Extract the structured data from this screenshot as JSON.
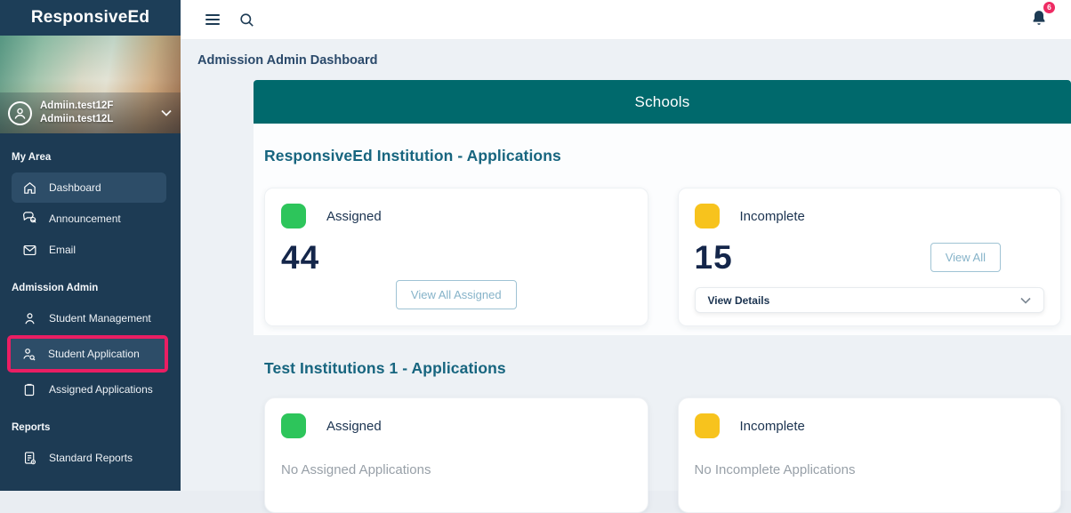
{
  "colors": {
    "sidebar_navy": "#1d3b54",
    "active_item_navy": "#2d4d68",
    "highlight_pink": "#ea1e63",
    "banner_teal": "#00696c",
    "heading_teal": "#17657f",
    "assigned_green": "#2dc55b",
    "incomplete_yellow": "#f7c31d",
    "number_navy": "#14264a",
    "badge_pink": "#ee2b63",
    "muted_gray": "#98a0a8"
  },
  "sidebar": {
    "logo": "ResponsiveEd",
    "user": {
      "line1": "Admiin.test12F",
      "line2": "Admiin.test12L"
    },
    "sections": [
      {
        "title": "My Area",
        "items": [
          {
            "label": "Dashboard",
            "icon": "home-icon",
            "active": true
          },
          {
            "label": "Announcement",
            "icon": "announcement-icon"
          },
          {
            "label": "Email",
            "icon": "email-icon"
          }
        ]
      },
      {
        "title": "Admission Admin",
        "items": [
          {
            "label": "Student Management",
            "icon": "person-icon"
          },
          {
            "label": "Student Application",
            "icon": "person-search-icon",
            "highlighted": true
          },
          {
            "label": "Assigned Applications",
            "icon": "clipboard-icon"
          }
        ]
      },
      {
        "title": "Reports",
        "items": [
          {
            "label": "Standard Reports",
            "icon": "report-icon"
          }
        ]
      }
    ]
  },
  "topbar": {
    "notification_count": "6"
  },
  "breadcrumb": {
    "title": "Admission Admin Dashboard"
  },
  "main": {
    "banner_title": "Schools",
    "sections": [
      {
        "heading": "ResponsiveEd Institution - Applications",
        "cards": [
          {
            "label": "Assigned",
            "value": "44",
            "button_label": "View All Assigned"
          },
          {
            "label": "Incomplete",
            "value": "15",
            "button_label": "View All",
            "details_label": "View Details"
          }
        ]
      },
      {
        "heading": "Test Institutions 1 - Applications",
        "cards": [
          {
            "label": "Assigned",
            "empty_text": "No Assigned Applications"
          },
          {
            "label": "Incomplete",
            "empty_text": "No Incomplete Applications"
          }
        ]
      }
    ]
  }
}
